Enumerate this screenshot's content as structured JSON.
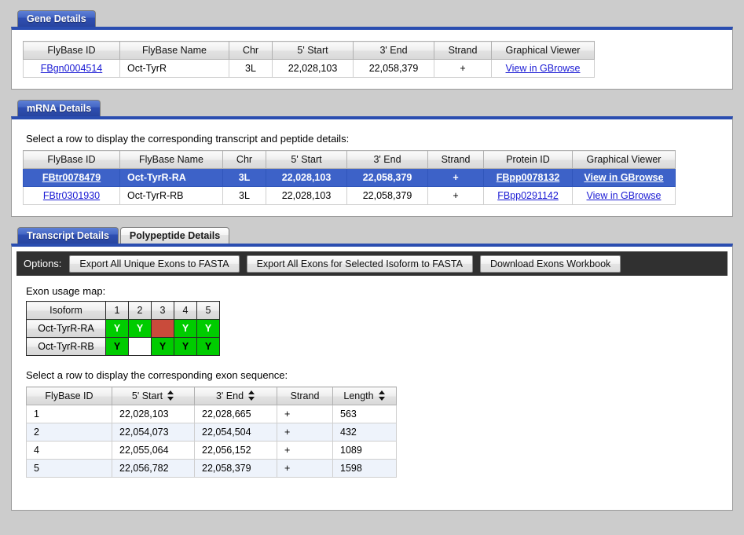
{
  "theme": {
    "page_background": "#cccccc",
    "panel_border_top": "#2a4db0",
    "tab_active": "#2f4fb4",
    "selected_row": "#3d62c8",
    "link": "#1a1ad4",
    "toolbar_background": "#303030",
    "exon_present": "#00cc00",
    "exon_excluded": "#c94b3b",
    "alt_row": "#eef3fb"
  },
  "gene_panel": {
    "tab_label": "Gene Details",
    "columns": [
      "FlyBase ID",
      "FlyBase Name",
      "Chr",
      "5' Start",
      "3' End",
      "Strand",
      "Graphical Viewer"
    ],
    "rows": [
      {
        "flybase_id": "FBgn0004514",
        "flybase_name": "Oct-TyrR",
        "chr": "3L",
        "start": "22,028,103",
        "end": "22,058,379",
        "strand": "+",
        "viewer": "View in GBrowse"
      }
    ]
  },
  "mrna_panel": {
    "tab_label": "mRNA Details",
    "instruction": "Select a row to display the corresponding transcript and peptide details:",
    "columns": [
      "FlyBase ID",
      "FlyBase Name",
      "Chr",
      "5' Start",
      "3' End",
      "Strand",
      "Protein ID",
      "Graphical Viewer"
    ],
    "rows": [
      {
        "flybase_id": "FBtr0078479",
        "flybase_name": "Oct-TyrR-RA",
        "chr": "3L",
        "start": "22,028,103",
        "end": "22,058,379",
        "strand": "+",
        "protein_id": "FBpp0078132",
        "viewer": "View in GBrowse",
        "selected": true
      },
      {
        "flybase_id": "FBtr0301930",
        "flybase_name": "Oct-TyrR-RB",
        "chr": "3L",
        "start": "22,028,103",
        "end": "22,058,379",
        "strand": "+",
        "protein_id": "FBpp0291142",
        "viewer": "View in GBrowse",
        "selected": false
      }
    ]
  },
  "detail_panel": {
    "tabs": [
      {
        "label": "Transcript Details",
        "active": true
      },
      {
        "label": "Polypeptide Details",
        "active": false
      }
    ],
    "options_bar": {
      "label": "Options:",
      "buttons": [
        "Export All Unique Exons to FASTA",
        "Export All Exons for Selected Isoform to FASTA",
        "Download Exons Workbook"
      ]
    },
    "exon_map": {
      "title": "Exon usage map:",
      "isoform_header": "Isoform",
      "exon_numbers": [
        "1",
        "2",
        "3",
        "4",
        "5"
      ],
      "rows": [
        {
          "isoform": "Oct-TyrR-RA",
          "cells": [
            {
              "state": "present-a",
              "label": "Y"
            },
            {
              "state": "present-a",
              "label": "Y"
            },
            {
              "state": "excluded",
              "label": ""
            },
            {
              "state": "present-a",
              "label": "Y"
            },
            {
              "state": "present-a",
              "label": "Y"
            }
          ]
        },
        {
          "isoform": "Oct-TyrR-RB",
          "cells": [
            {
              "state": "present-b",
              "label": "Y"
            },
            {
              "state": "absent",
              "label": ""
            },
            {
              "state": "present-b",
              "label": "Y"
            },
            {
              "state": "present-b",
              "label": "Y"
            },
            {
              "state": "present-b",
              "label": "Y"
            }
          ]
        }
      ]
    },
    "exon_table": {
      "instruction": "Select a row to display the corresponding exon sequence:",
      "columns": [
        {
          "label": "FlyBase ID",
          "sortable": false
        },
        {
          "label": "5' Start",
          "sortable": true
        },
        {
          "label": "3' End",
          "sortable": true
        },
        {
          "label": "Strand",
          "sortable": false
        },
        {
          "label": "Length",
          "sortable": true
        }
      ],
      "rows": [
        {
          "id": "1",
          "start": "22,028,103",
          "end": "22,028,665",
          "strand": "+",
          "length": "563"
        },
        {
          "id": "2",
          "start": "22,054,073",
          "end": "22,054,504",
          "strand": "+",
          "length": "432"
        },
        {
          "id": "4",
          "start": "22,055,064",
          "end": "22,056,152",
          "strand": "+",
          "length": "1089"
        },
        {
          "id": "5",
          "start": "22,056,782",
          "end": "22,058,379",
          "strand": "+",
          "length": "1598"
        }
      ]
    }
  }
}
